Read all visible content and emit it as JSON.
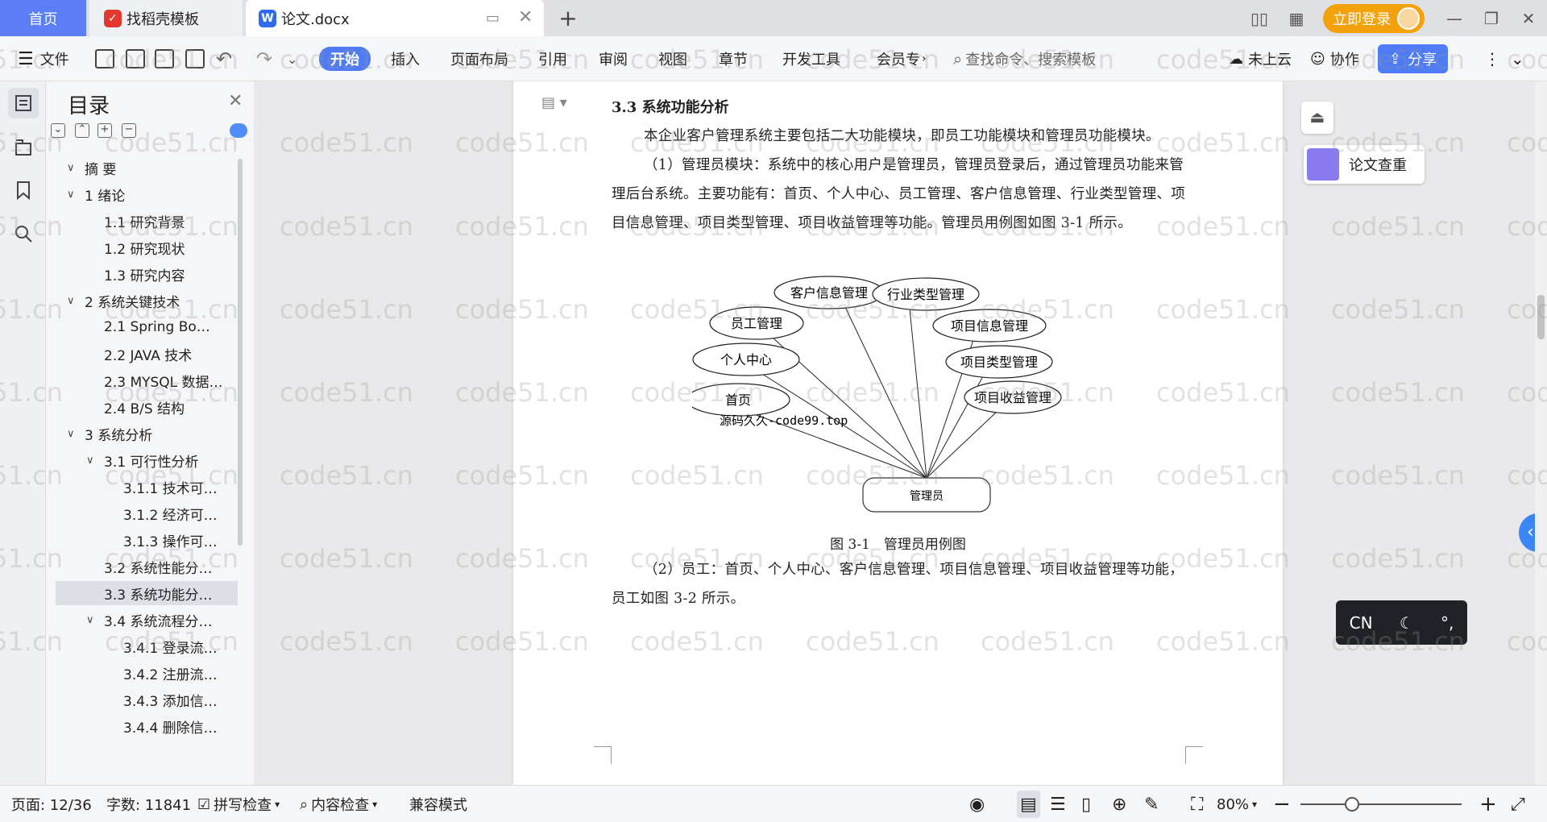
{
  "tabs": {
    "home": "首页",
    "template": "找稻壳模板",
    "doc": "论文.docx"
  },
  "account": {
    "login": "立即登录"
  },
  "ribbon": {
    "file": "文件",
    "start": "开始",
    "insert": "插入",
    "layout": "页面布局",
    "reference": "引用",
    "review": "审阅",
    "view": "视图",
    "chapter": "章节",
    "devtools": "开发工具",
    "member": "会员专",
    "search_placeholder": "查找命令、搜索模板",
    "cloud": "未上云",
    "collab": "协作",
    "share": "分享"
  },
  "toc": {
    "title": "目录",
    "items": [
      {
        "label": "摘 要",
        "level": 0,
        "chev": "v"
      },
      {
        "label": "1 绪论",
        "level": 0,
        "chev": "v"
      },
      {
        "label": "1.1 研究背景",
        "level": 1
      },
      {
        "label": "1.2 研究现状",
        "level": 1
      },
      {
        "label": "1.3 研究内容",
        "level": 1
      },
      {
        "label": "2 系统关键技术",
        "level": 0,
        "chev": "v"
      },
      {
        "label": "2.1 Spring Bo…",
        "level": 1
      },
      {
        "label": "2.2 JAVA 技术",
        "level": 1
      },
      {
        "label": "2.3 MYSQL 数据…",
        "level": 1
      },
      {
        "label": "2.4 B/S 结构",
        "level": 1
      },
      {
        "label": "3 系统分析",
        "level": 0,
        "chev": "v"
      },
      {
        "label": "3.1 可行性分析",
        "level": 1,
        "chev": "v"
      },
      {
        "label": "3.1.1 技术可…",
        "level": 2
      },
      {
        "label": "3.1.2 经济可…",
        "level": 2
      },
      {
        "label": "3.1.3 操作可…",
        "level": 2
      },
      {
        "label": "3.2 系统性能分…",
        "level": 1
      },
      {
        "label": "3.3 系统功能分…",
        "level": 1,
        "selected": true
      },
      {
        "label": "3.4 系统流程分…",
        "level": 1,
        "chev": "v"
      },
      {
        "label": "3.4.1 登录流…",
        "level": 2
      },
      {
        "label": "3.4.2 注册流…",
        "level": 2
      },
      {
        "label": "3.4.3 添加信…",
        "level": 2
      },
      {
        "label": "3.4.4 删除信…",
        "level": 2
      }
    ]
  },
  "document": {
    "heading": "3.3 系统功能分析",
    "para1": "本企业客户管理系统主要包括二大功能模块，即员工功能模块和管理员功能模块。",
    "para2": "（1）管理员模块：系统中的核心用户是管理员，管理员登录后，通过管理员功能来管理后台系统。主要功能有：首页、个人中心、员工管理、客户信息管理、行业类型管理、项目信息管理、项目类型管理、项目收益管理等功能。管理员用例图如图 3-1 所示。",
    "diagram": {
      "center": "管理员",
      "nodes": [
        "客户信息管理",
        "行业类型管理",
        "员工管理",
        "项目信息管理",
        "个人中心",
        "项目类型管理",
        "首页",
        "项目收益管理"
      ],
      "overlay": "源码久久-code99.top"
    },
    "caption": "图 3-1　管理员用例图",
    "para3": "（2）员工：首页、个人中心、客户信息管理、项目信息管理、项目收益管理等功能，员工如图 3-2 所示。"
  },
  "side": {
    "check": "论文查重",
    "ime": "CN"
  },
  "status": {
    "page": "页面: 12/36",
    "words": "字数: 11841",
    "spell": "拼写检查",
    "content": "内容检查",
    "compat": "兼容模式",
    "zoom": "80%",
    "zoom_fraction": 0.32
  },
  "watermark": "code51.cn"
}
